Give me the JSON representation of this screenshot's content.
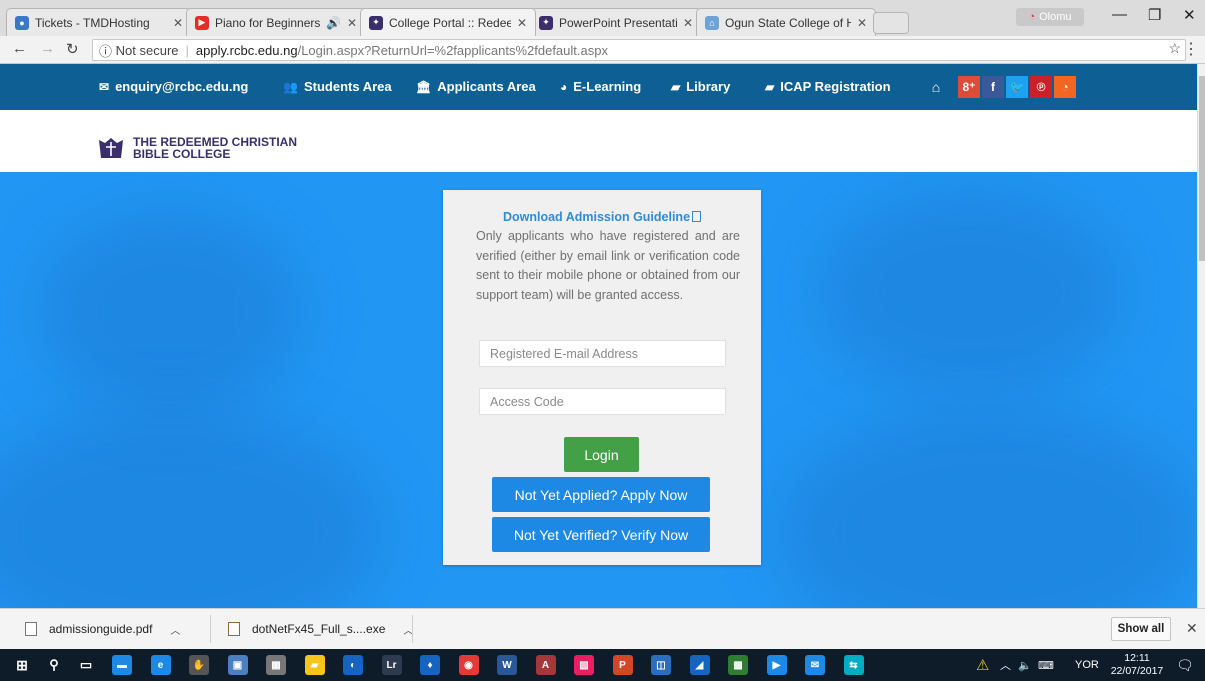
{
  "browser": {
    "tabs": [
      {
        "label": "Tickets - TMDHosting",
        "color": "#3b78c4",
        "glyph": "TMD"
      },
      {
        "label": "Piano for Beginners, L",
        "color": "#e52d27",
        "glyph": "▶"
      },
      {
        "label": "College Portal :: Redeem",
        "color": "#3a2f6b",
        "glyph": "✦"
      },
      {
        "label": "PowerPoint Presentation",
        "color": "#3a2f6b",
        "glyph": "✦"
      },
      {
        "label": "Ogun State College of H",
        "color": "#6fa3d6",
        "glyph": "⌂"
      }
    ],
    "profile": "Olomu",
    "url_security": "Not secure",
    "url_host": "apply.rcbc.edu.ng",
    "url_path": "/Login.aspx?ReturnUrl=%2fapplicants%2fdefault.aspx"
  },
  "site_nav": {
    "email": "enquiry@rcbc.edu.ng",
    "items": [
      "Students Area",
      "Applicants Area",
      "E-Learning",
      "Library",
      "ICAP Registration"
    ],
    "social": [
      {
        "glyph": "8⁺",
        "color": "#dd4b39"
      },
      {
        "glyph": "f",
        "color": "#3b5998"
      },
      {
        "glyph": "🐦",
        "color": "#1da1f2"
      },
      {
        "glyph": "℗",
        "color": "#cb2027"
      },
      {
        "glyph": "◔",
        "color": "#f26522"
      }
    ]
  },
  "logo": {
    "line1": "THE REDEEMED CHRISTIAN",
    "line2": "BIBLE COLLEGE"
  },
  "login": {
    "download_link": "Download Admission Guideline",
    "notice": "Only applicants who have registered and are verified (either by email link or verification code sent to their mobile phone or obtained from our support team) will be granted access.",
    "email_placeholder": "Registered E-mail Address",
    "code_placeholder": "Access Code",
    "login_label": "Login",
    "apply_label": "Not Yet Applied? Apply Now",
    "verify_label": "Not Yet Verified? Verify Now"
  },
  "downloads": {
    "items": [
      "admissionguide.pdf",
      "dotNetFx45_Full_s....exe"
    ],
    "show_all": "Show all"
  },
  "taskbar": {
    "apps": [
      {
        "glyph": "▬",
        "color": "#1e88e5"
      },
      {
        "glyph": "e",
        "color": "#1e88e5"
      },
      {
        "glyph": "✋",
        "color": "#555"
      },
      {
        "glyph": "▣",
        "color": "#4a7fc1"
      },
      {
        "glyph": "▦",
        "color": "#777"
      },
      {
        "glyph": "▰",
        "color": "#f5c518"
      },
      {
        "glyph": "◐",
        "color": "#1565c0"
      },
      {
        "glyph": "Lr",
        "color": "#2e3b4e"
      },
      {
        "glyph": "♦",
        "color": "#1565c0"
      },
      {
        "glyph": "◉",
        "color": "#e53935"
      },
      {
        "glyph": "W",
        "color": "#2b5797"
      },
      {
        "glyph": "A",
        "color": "#a4373a"
      },
      {
        "glyph": "▧",
        "color": "#e91e63"
      },
      {
        "glyph": "P",
        "color": "#d24726"
      },
      {
        "glyph": "◫",
        "color": "#2a6ebf"
      },
      {
        "glyph": "◢",
        "color": "#1565c0"
      },
      {
        "glyph": "▩",
        "color": "#2e7d32"
      },
      {
        "glyph": "▶",
        "color": "#1e88e5"
      },
      {
        "glyph": "✉",
        "color": "#1e88e5"
      },
      {
        "glyph": "⇆",
        "color": "#00acc1"
      }
    ],
    "language": "YOR",
    "time": "12:11",
    "date": "22/07/2017"
  }
}
